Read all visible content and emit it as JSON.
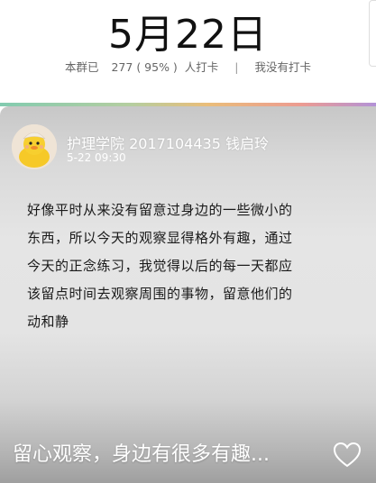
{
  "header": {
    "date": "5月22日",
    "checked_in_prefix": "本群已",
    "checked_in_count": "277 ( 95% )",
    "checked_in_suffix": "人打卡",
    "separator": "|",
    "my_status": "我没有打卡"
  },
  "post": {
    "author": "护理学院 2017104435 钱启玲",
    "time": "5-22 09:30",
    "body_lines": [
      "好像平时从来没有留意过身边的一些微小的",
      "东西，所以今天的观察显得格外有趣，通过",
      "今天的正念练习，我觉得以后的每一天都应",
      "该留点时间去观察周围的事物，留意他们的",
      "动和静"
    ],
    "caption": "留心观察，身边有很多有趣...",
    "like_icon": "heart-outline-icon"
  },
  "colors": {
    "title_text": "#111111",
    "stats_text": "#666666",
    "card_gray": "#e4e4e4",
    "white_text": "#ffffff"
  }
}
